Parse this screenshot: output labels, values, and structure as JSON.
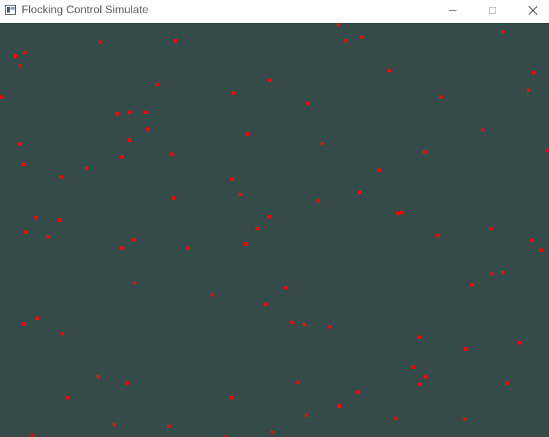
{
  "window": {
    "title": "Flocking Control Simulate",
    "icon": "app-window-icon",
    "controls": {
      "minimize": "minimize-icon",
      "maximize": "maximize-icon",
      "close": "close-icon"
    }
  },
  "simulation": {
    "background_color": "#354b4a",
    "agent_color": "#ff0000"
  }
}
